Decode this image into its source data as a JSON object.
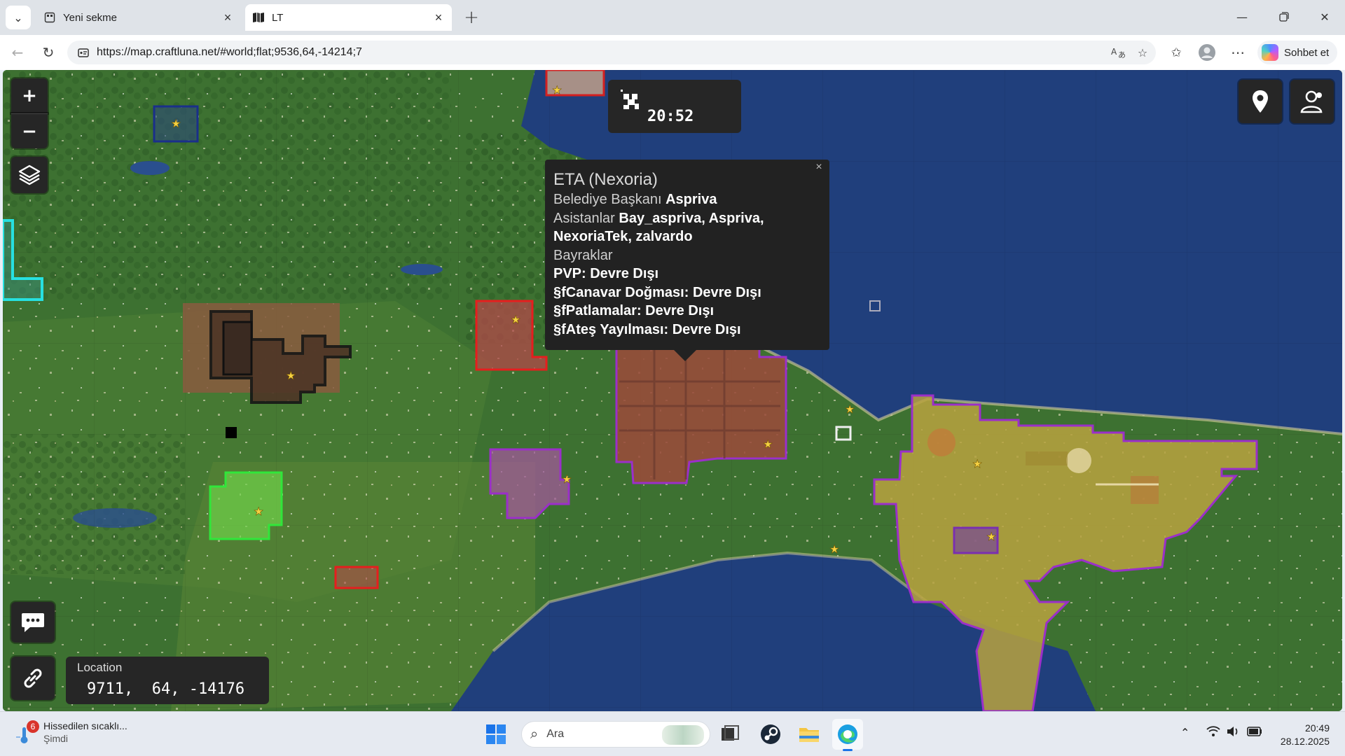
{
  "browser": {
    "tabs": [
      {
        "title": "Yeni sekme",
        "icon": "new-tab-page-icon",
        "active": false
      },
      {
        "title": "LT",
        "icon": "site-favicon-icon",
        "active": true
      }
    ],
    "url": "https://map.craftluna.net/#world;flat;9536,64,-14214;7",
    "copilot_label": "Sohbet et"
  },
  "map": {
    "clock": "20:52",
    "popup": {
      "title": "ETA (Nexoria)",
      "mayor_label": "Belediye Başkanı",
      "mayor": "Aspriva",
      "assistants_label": "Asistanlar",
      "assistants_line1": "Bay_aspriva, Aspriva,",
      "assistants_line2": "NexoriaTek, zalvardo",
      "flags_label": "Bayraklar",
      "flags": [
        "PVP: Devre Dışı",
        "§fCanavar Doğması: Devre Dışı",
        "§fPatlamalar: Devre Dışı",
        "§fAteş Yayılması: Devre Dışı"
      ],
      "close_glyph": "×"
    },
    "location": {
      "label": "Location",
      "value": "9711,  64, -14176"
    },
    "zoom_in": "+",
    "zoom_out": "−"
  },
  "taskbar": {
    "weather_title": "Hissedilen sıcaklı...",
    "weather_sub": "Şimdi",
    "weather_badge": "6",
    "search_placeholder": "Ara",
    "time": "20:49",
    "date": "28.12.2025"
  },
  "colors": {
    "land": "#3b6f2f",
    "water": "#1f3f7a",
    "town_brown": "#7a4a33",
    "town_gold": "#a79a3a",
    "border_purple": "#9b2fc9",
    "border_red": "#e02020"
  }
}
